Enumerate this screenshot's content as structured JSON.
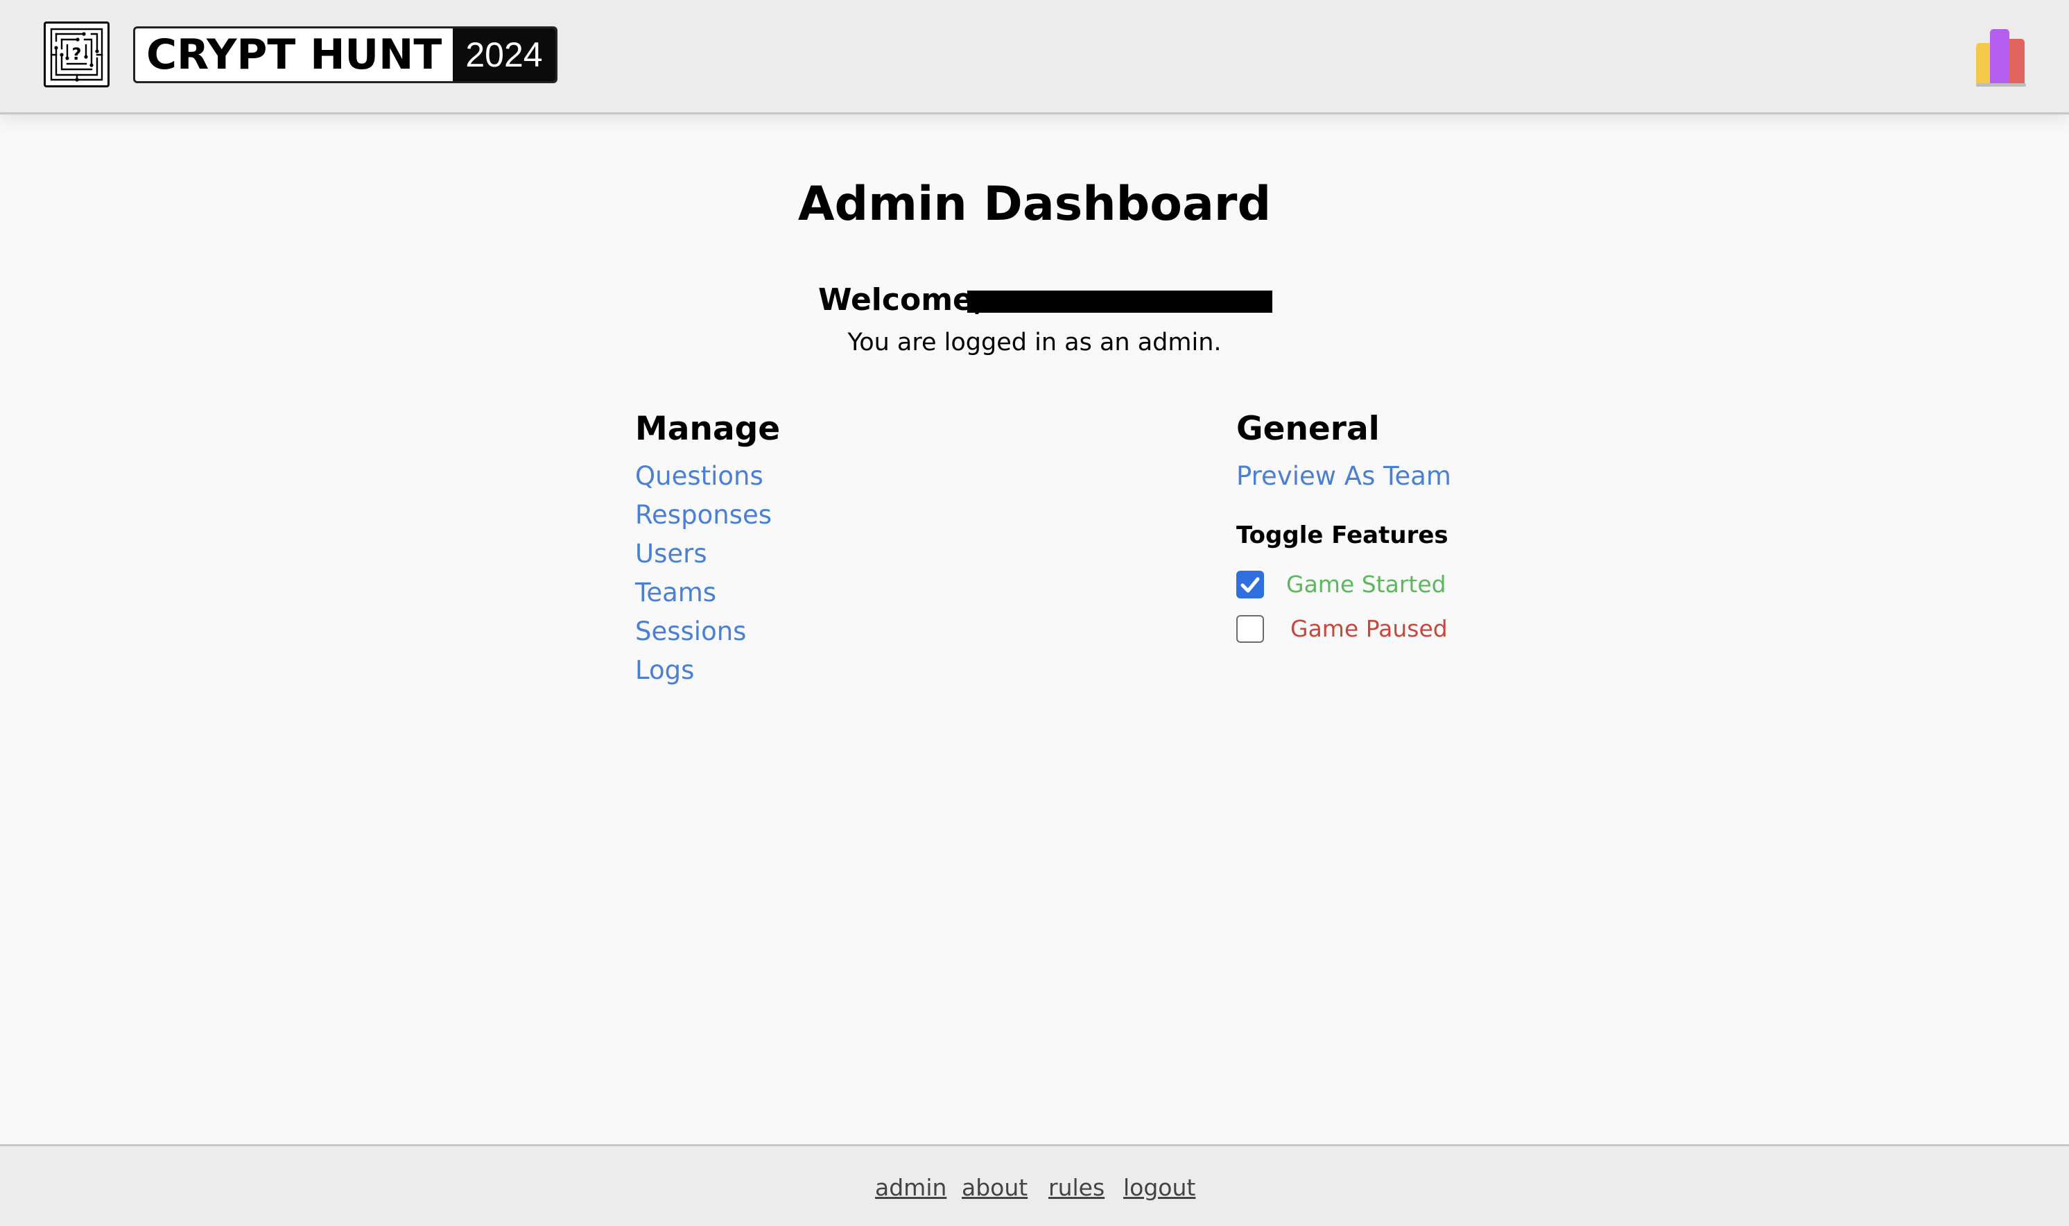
{
  "header": {
    "brand_name": "CRYPT HUNT",
    "brand_year": "2024",
    "logo_icon": "maze-question-icon",
    "account_icon": "stacked-books-icon"
  },
  "main": {
    "title": "Admin Dashboard",
    "welcome": "Welcome,",
    "subtitle": "You are logged in as an admin."
  },
  "manage": {
    "heading": "Manage",
    "links": [
      "Questions",
      "Responses",
      "Users",
      "Teams",
      "Sessions",
      "Logs"
    ]
  },
  "general": {
    "heading": "General",
    "preview_link": "Preview As Team",
    "toggle_heading": "Toggle Features",
    "toggles": [
      {
        "label": "Game Started",
        "checked": true,
        "color": "#5cb85c"
      },
      {
        "label": "Game Paused",
        "checked": false,
        "color": "#c9463d"
      }
    ]
  },
  "footer": {
    "links": [
      "admin",
      "about",
      "rules",
      "logout"
    ]
  },
  "colors": {
    "link": "#4a7fd3",
    "checkbox_checked": "#2f6fe0",
    "header_bg": "#ececec",
    "page_bg": "#f9f9f9"
  }
}
